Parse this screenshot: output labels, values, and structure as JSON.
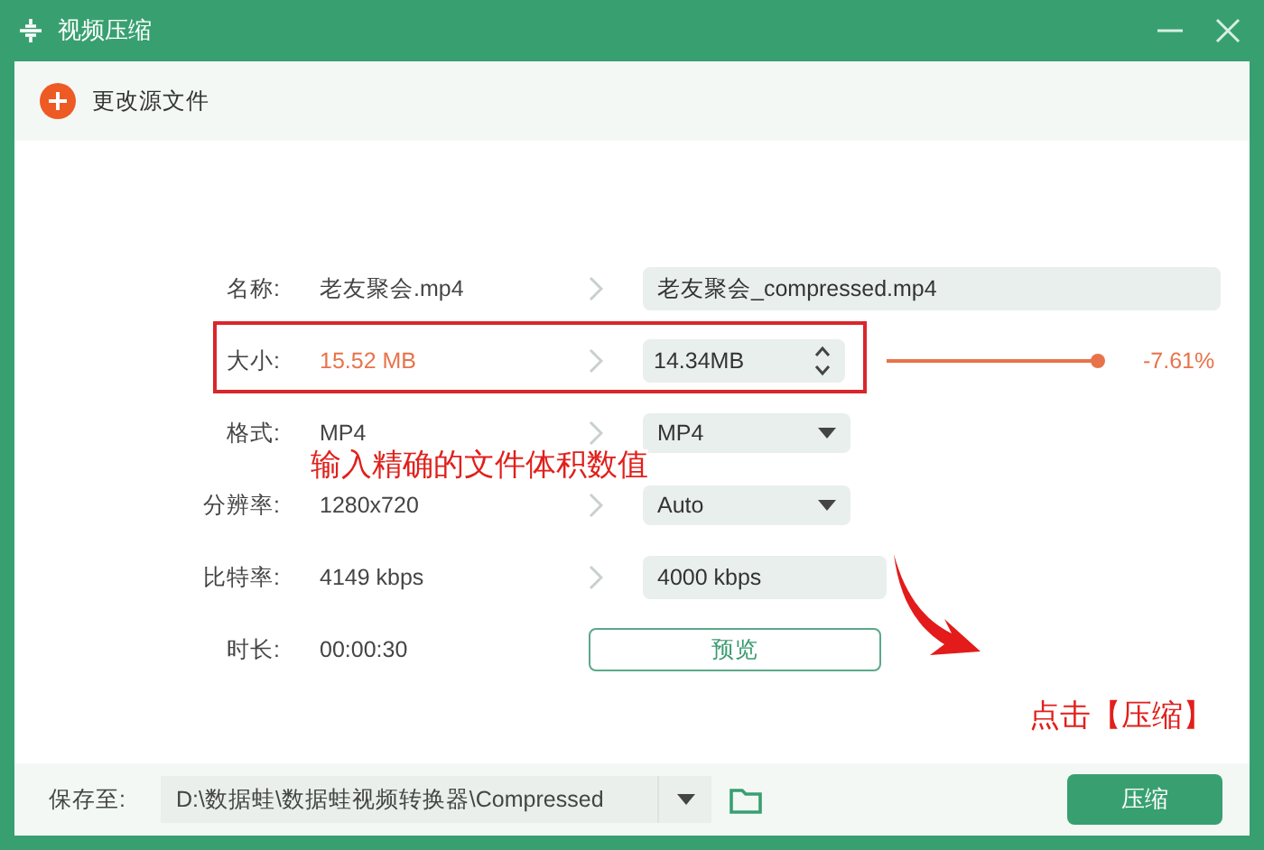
{
  "window": {
    "title": "视频压缩"
  },
  "toolbar": {
    "change_source": "更改源文件"
  },
  "rows": [
    {
      "kind": "text",
      "label": "名称:",
      "source": "老友聚会.mp4",
      "target": "老友聚会_compressed.mp4"
    },
    {
      "kind": "size",
      "label": "大小:",
      "source": "15.52 MB",
      "target": "14.34MB",
      "level": 0.99,
      "reading": "-7.61%",
      "highlighted": true
    },
    {
      "kind": "select",
      "label": "格式:",
      "source": "MP4",
      "target": "MP4"
    },
    {
      "kind": "select",
      "label": "分辨率:",
      "source": "1280x720",
      "target": "Auto"
    },
    {
      "kind": "input",
      "label": "比特率:",
      "source": "4149 kbps",
      "target": "4000 kbps"
    },
    {
      "kind": "button",
      "label": "时长:",
      "source": "00:00:30",
      "target": "预览"
    }
  ],
  "annotations": {
    "size_hint": "输入精确的文件体积数值",
    "compress_hint": "点击【压缩】"
  },
  "footer": {
    "label": "保存至:",
    "path": "D:\\数据蛙\\数据蛙视频转换器\\Compressed",
    "compress_button": "压缩"
  }
}
